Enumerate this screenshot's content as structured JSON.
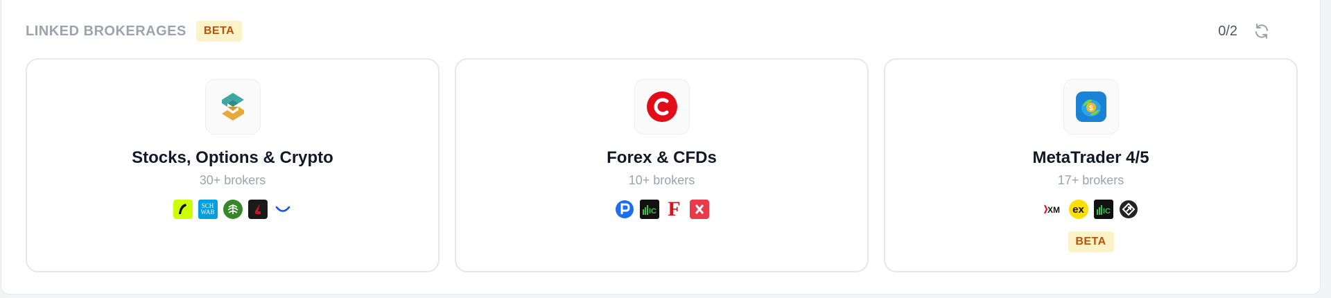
{
  "header": {
    "title": "LINKED BROKERAGES",
    "badge": "BETA",
    "count": "0/2",
    "refresh_icon": "refresh-icon"
  },
  "colors": {
    "badge_bg": "#fef3c7",
    "badge_text": "#b45309",
    "title_gray": "#9ca3af"
  },
  "cards": [
    {
      "title": "Stocks, Options & Crypto",
      "subtitle": "30+ brokers",
      "logo_icon": "snaptrade-logo-icon",
      "brokers": [
        "robinhood-icon",
        "schwab-icon",
        "fidelity-icon",
        "interactive-brokers-icon",
        "coinbase-icon"
      ]
    },
    {
      "title": "Forex & CFDs",
      "subtitle": "10+ brokers",
      "logo_icon": "ctrader-logo-icon",
      "brokers": [
        "pepperstone-icon",
        "ic-markets-icon",
        "fxcm-icon",
        "fxtm-icon"
      ]
    },
    {
      "title": "MetaTrader 4/5",
      "subtitle": "17+ brokers",
      "logo_icon": "metatrader-logo-icon",
      "brokers": [
        "xm-icon",
        "exness-icon",
        "ic-markets-icon",
        "fxpro-icon"
      ],
      "badge": "BETA"
    }
  ]
}
